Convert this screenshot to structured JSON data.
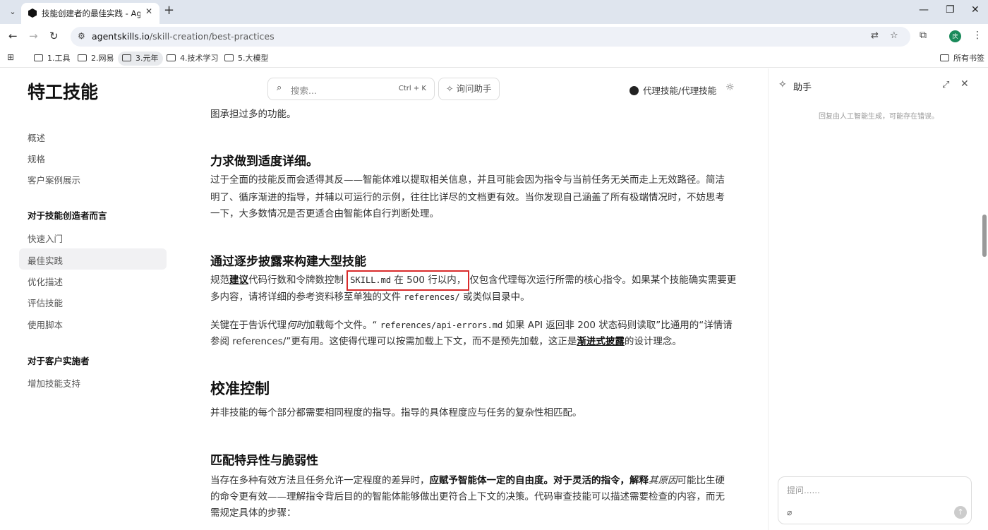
{
  "browser": {
    "tab_title": "技能创建者的最佳实践 - Agent",
    "url_host": "agentskills.io",
    "url_path": "/skill-creation/best-practices",
    "profile_initial": "庆",
    "bookmarks": [
      "1.工具",
      "2.网易",
      "3.元年",
      "4.技术学习",
      "5.大模型"
    ],
    "all_bookmarks": "所有书签"
  },
  "header": {
    "site_title": "特工技能",
    "search_placeholder": "搜索...",
    "search_shortcut": "Ctrl + K",
    "ask_button": "询问助手",
    "github_link": "代理技能/代理技能"
  },
  "sidebar": {
    "items_top": [
      "概述",
      "规格",
      "客户案例展示"
    ],
    "section1_title": "对于技能创造者而言",
    "section1_items": [
      "快速入门",
      "最佳实践",
      "优化描述",
      "评估技能",
      "使用脚本"
    ],
    "section2_title": "对于客户实施者",
    "section2_items": [
      "增加技能支持"
    ]
  },
  "content": {
    "line0": "图承担过多的功能。",
    "h_detail": "力求做到适度详细。",
    "p_detail_1": "过于全面的技能反而会适得其反——智能体难以提取相关信息，并且可能会因为指令与当前任务无关而走上无效路径。简洁",
    "p_detail_2": "明了、循序渐进的指导，并辅以可运行的示例，往往比详尽的文档更有效。当你发现自己涵盖了所有极端情况时，不妨思考",
    "p_detail_3": "一下，大多数情况是否更适合由智能体自行判断处理。",
    "h_disclosure": "通过逐步披露来构建大型技能",
    "p_disc_a1": "规范",
    "p_disc_a2": "建议",
    "p_disc_a3": "代码行数和令牌数控制",
    "p_disc_code1": "SKILL.md",
    "p_disc_a4": " 在 500 行以内，",
    "p_disc_a5": "仅包含代理每次运行所需的核心指令。如果某个技能确实需要更",
    "p_disc_b1": "多内容，请将详细的参考资料移至单独的文件 ",
    "p_disc_code2": "references/",
    "p_disc_b2": " 或类似目录中。",
    "p_key_a1": "关键在于告诉代理",
    "p_key_a2": "何时",
    "p_key_a3": "加载每个文件。“ ",
    "p_key_code": "references/api-errors.md",
    "p_key_a4": " 如果 API 返回非 200 状态码则读取”比通用的“详情请",
    "p_key_b1": "参阅 references/”更有用。这使得代理可以按需加载上下文，而不是预先加载，这正是",
    "p_key_b2": "渐进式披露",
    "p_key_b3": "的设计理念。",
    "h_calibrate": "校准控制",
    "p_calibrate": "并非技能的每个部分都需要相同程度的指导。指导的具体程度应与任务的复杂性相匹配。",
    "h_match": "匹配特异性与脆弱性",
    "p_match_a1": "当存在多种有效方法且任务允许一定程度的差异时，",
    "p_match_a2": "应赋予智能体一定的自由度。对于灵活的指令，解释",
    "p_match_a3": "其原因",
    "p_match_a4": "可能比生硬",
    "p_match_b": "的命令更有效——理解指令背后目的的智能体能够做出更符合上下文的决策。代码审查技能可以描述需要检查的内容，而无",
    "p_match_c": "需规定具体的步骤："
  },
  "assistant": {
    "title": "助手",
    "note": "回复由人工智能生成，可能存在错误。",
    "input_placeholder": "提问......"
  }
}
